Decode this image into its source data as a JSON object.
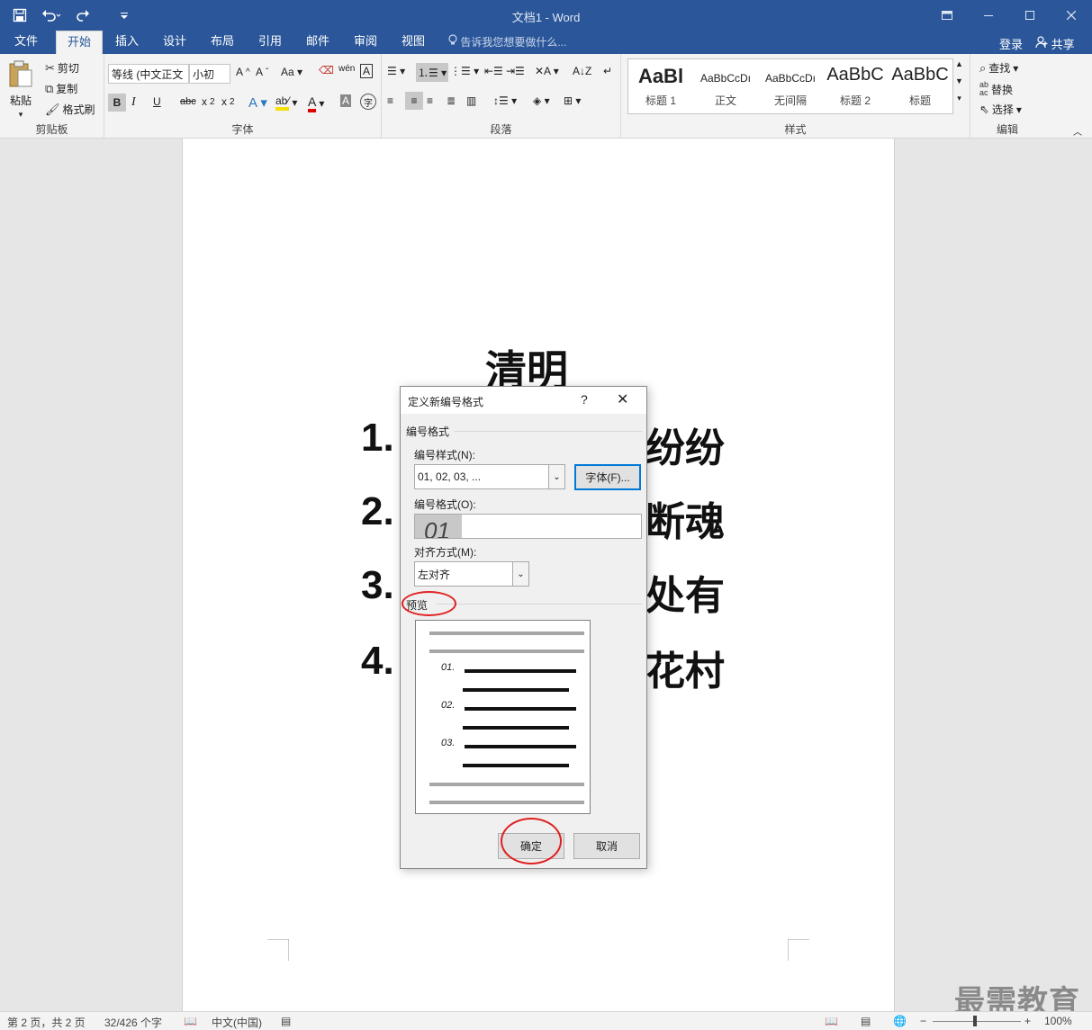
{
  "titlebar": {
    "title": "文档1 - Word",
    "qat": {
      "save_icon": "save-icon",
      "undo_icon": "undo-icon",
      "redo_icon": "redo-icon",
      "customize_icon": "customize-qat-icon"
    }
  },
  "tabs": [
    {
      "label": "文件"
    },
    {
      "label": "开始"
    },
    {
      "label": "插入"
    },
    {
      "label": "设计"
    },
    {
      "label": "布局"
    },
    {
      "label": "引用"
    },
    {
      "label": "邮件"
    },
    {
      "label": "审阅"
    },
    {
      "label": "视图"
    }
  ],
  "tellme": "告诉我您想要做什么...",
  "account": {
    "signin": "登录",
    "share": "共享"
  },
  "ribbon": {
    "clipboard": {
      "label": "剪贴板",
      "paste": "粘贴",
      "cut": "剪切",
      "copy": "复制",
      "format_painter": "格式刷"
    },
    "font": {
      "label": "字体",
      "font_name": "等线 (中文正文",
      "font_size": "小初",
      "bold": "B",
      "italic": "I",
      "underline": "U",
      "strike": "abc"
    },
    "paragraph": {
      "label": "段落"
    },
    "styles": {
      "label": "样式",
      "items": [
        {
          "preview": "AaBl",
          "name": "标题 1"
        },
        {
          "preview": "AaBbCcDı",
          "name": "正文"
        },
        {
          "preview": "AaBbCcDı",
          "name": "无间隔"
        },
        {
          "preview": "AaBbC",
          "name": "标题 2"
        },
        {
          "preview": "AaBbC",
          "name": "标题"
        }
      ]
    },
    "editing": {
      "label": "编辑",
      "find": "查找",
      "replace": "替换",
      "select": "选择"
    }
  },
  "document": {
    "title": "清明",
    "lines": [
      {
        "num": "1.",
        "tail": "纷纷"
      },
      {
        "num": "2.",
        "tail": "断魂"
      },
      {
        "num": "3.",
        "tail": "处有"
      },
      {
        "num": "4.",
        "tail": "花村"
      }
    ]
  },
  "dialog": {
    "title": "定义新编号格式",
    "help": "?",
    "close": "✕",
    "numbering_format_group": "编号格式",
    "numbering_style_label": "编号样式(N):",
    "numbering_style_value": "01, 02, 03, ...",
    "font_button": "字体(F)...",
    "number_format_label": "编号格式(O):",
    "number_format_value": "01",
    "alignment_label": "对齐方式(M):",
    "alignment_value": "左对齐",
    "preview_label": "预览",
    "preview_numbers": [
      "01.",
      "02.",
      "03."
    ],
    "ok": "确定",
    "cancel": "取消"
  },
  "watermark": "最需教育",
  "statusbar": {
    "page": "第 2 页，共 2 页",
    "words": "32/426 个字",
    "language": "中文(中国)",
    "zoom": "100%"
  },
  "colors": {
    "word_blue": "#2b579a",
    "annotation_red": "#e02020"
  }
}
